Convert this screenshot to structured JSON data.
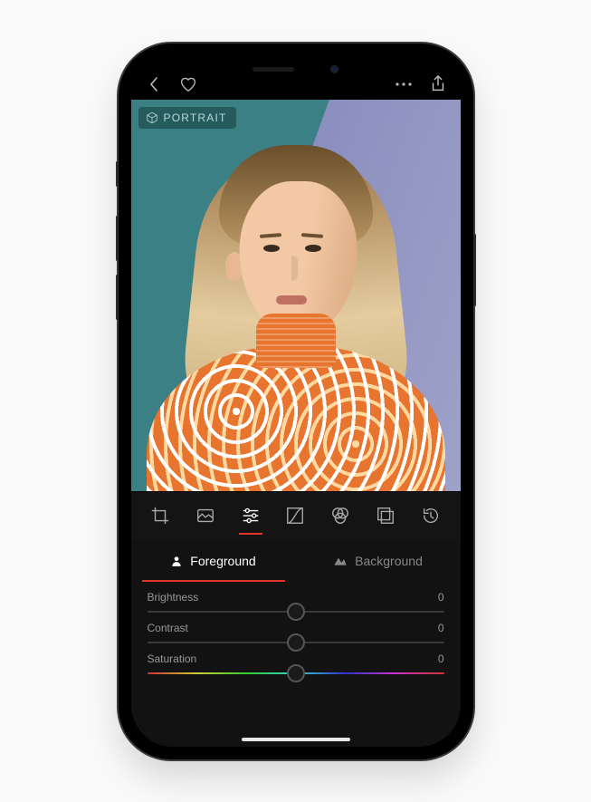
{
  "badge": {
    "label": "PORTRAIT"
  },
  "topbar": {
    "back_icon": "chevron-left",
    "favorite_icon": "heart",
    "more_icon": "ellipsis",
    "share_icon": "share"
  },
  "tools": [
    {
      "name": "crop-icon"
    },
    {
      "name": "filters-icon"
    },
    {
      "name": "adjust-icon",
      "active": true
    },
    {
      "name": "curves-icon"
    },
    {
      "name": "color-mix-icon"
    },
    {
      "name": "layers-icon"
    },
    {
      "name": "history-icon"
    }
  ],
  "subject_tabs": {
    "foreground": {
      "label": "Foreground",
      "icon": "person-icon",
      "active": true
    },
    "background": {
      "label": "Background",
      "icon": "mountains-icon",
      "active": false
    }
  },
  "sliders": [
    {
      "label": "Brightness",
      "value": "0",
      "position": 50,
      "rainbow": false
    },
    {
      "label": "Contrast",
      "value": "0",
      "position": 50,
      "rainbow": false
    },
    {
      "label": "Saturation",
      "value": "0",
      "position": 50,
      "rainbow": true
    }
  ],
  "colors": {
    "accent": "#e5342e"
  }
}
